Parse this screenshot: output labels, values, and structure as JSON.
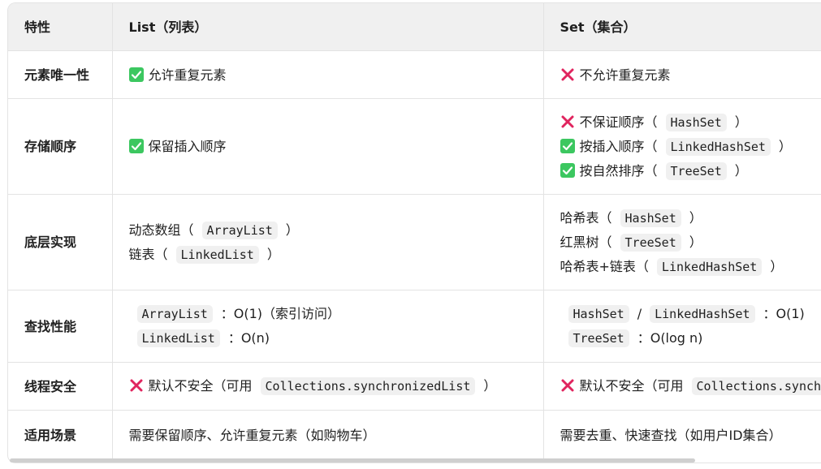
{
  "headers": [
    "特性",
    "List（列表）",
    "Set（集合）"
  ],
  "rows": {
    "r1": {
      "label": "元素唯一性",
      "list": {
        "text": "允许重复元素"
      },
      "set": {
        "text": "不允许重复元素"
      }
    },
    "r2": {
      "label": "存储顺序",
      "list": {
        "text": "保留插入顺序"
      },
      "set": [
        {
          "pre": "不保证顺序（",
          "code": "HashSet",
          "post": "）"
        },
        {
          "pre": "按插入顺序（",
          "code": "LinkedHashSet",
          "post": "）"
        },
        {
          "pre": "按自然排序（",
          "code": "TreeSet",
          "post": "）"
        }
      ]
    },
    "r3": {
      "label": "底层实现",
      "list": [
        {
          "pre": "动态数组（",
          "code": "ArrayList",
          "post": "）"
        },
        {
          "pre": "链表（",
          "code": "LinkedList",
          "post": "）"
        }
      ],
      "set": [
        {
          "pre": "哈希表（",
          "code": "HashSet",
          "post": "）"
        },
        {
          "pre": "红黑树（",
          "code": "TreeSet",
          "post": "）"
        },
        {
          "pre": "哈希表+链表（",
          "code": "LinkedHashSet",
          "post": "）"
        }
      ]
    },
    "r4": {
      "label": "查找性能",
      "list": [
        {
          "code": "ArrayList",
          "post": "：O(1)（索引访问）"
        },
        {
          "code": "LinkedList",
          "post": "：O(n)"
        }
      ],
      "set": [
        {
          "code": "HashSet",
          "mid": "/",
          "code2": "LinkedHashSet",
          "post": "：O(1)"
        },
        {
          "code": "TreeSet",
          "post": "：O(log n)"
        }
      ]
    },
    "r5": {
      "label": "线程安全",
      "list": {
        "pre": "默认不安全（可用",
        "code": "Collections.synchronizedList",
        "post": "）"
      },
      "set": {
        "pre": "默认不安全（可用",
        "code": "Collections.synchronizedSet",
        "post": "）"
      }
    },
    "r6": {
      "label": "适用场景",
      "list": {
        "text": "需要保留顺序、允许重复元素（如购物车）"
      },
      "set": {
        "text": "需要去重、快速查找（如用户ID集合）"
      }
    }
  },
  "icons": {
    "check": "check-icon",
    "cross": "cross-icon"
  },
  "colors": {
    "check": "#3cc760",
    "cross": "#e0245e",
    "header_bg": "#f0f0f0",
    "border": "#e3e3e3",
    "code_bg": "#f0f0f0"
  }
}
